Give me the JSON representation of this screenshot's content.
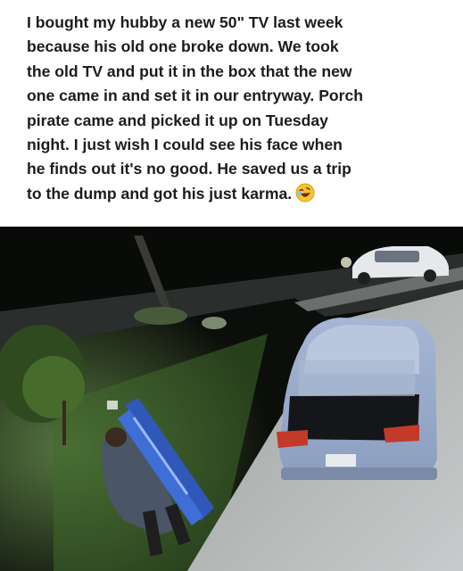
{
  "post": {
    "lines": [
      "I bought my hubby a new 50\" TV last week",
      "because his old one broke down. We took",
      "the old TV and put it in the box that the new",
      "one came in and set it in our entryway. Porch",
      "pirate came and picked it up on Tuesday",
      "night. I just wish I could see his face when",
      "he finds out it's no good. He saved us a trip",
      "to the dump and got his just karma."
    ],
    "emoji_icon": "rolling-laughing-emoji"
  },
  "photo": {
    "description_icon": "security-camera-night-photo",
    "colors": {
      "grass": "#3f6a2c",
      "driveway": "#b9bdbd",
      "car": "#9fb0cf",
      "box": "#2f58b8"
    }
  }
}
